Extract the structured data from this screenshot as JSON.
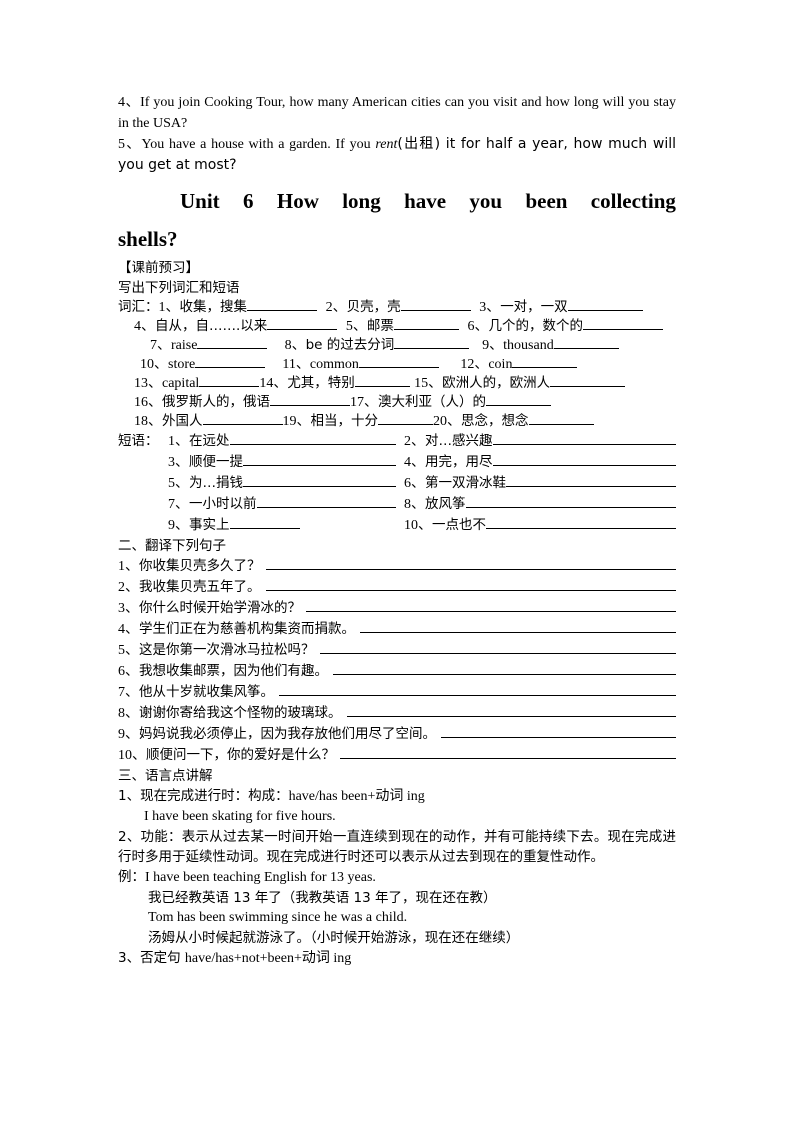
{
  "prev_questions": [
    {
      "number": "4、",
      "text": "If you join Cooking Tour, how many American cities can you visit and how long will you stay in the USA?"
    },
    {
      "number": "5、",
      "text_before_italic": "You have a house with a garden. If you ",
      "italic_word": "rent",
      "text_after_italic": "(出租) it for half a year, how much will you get at most?"
    }
  ],
  "unit_title": {
    "line1": "Unit 6 How long have you been collecting",
    "line1_words": [
      "Unit",
      "6",
      "How",
      "long",
      "have",
      "you",
      "been",
      "collecting"
    ],
    "line2": "shells?"
  },
  "preview": {
    "heading": "【课前预习】",
    "subheading": "写出下列词汇和短语",
    "vocab_label": "词汇：",
    "vocab_items": [
      {
        "num": "1、",
        "text": "收集，搜集",
        "blank": "b70"
      },
      {
        "num": "2、",
        "text": "贝壳，壳",
        "blank": "b70"
      },
      {
        "num": "3、",
        "text": "一对，一双",
        "blank": "b75"
      },
      {
        "num": "4、",
        "text": "自从，自…….以来",
        "blank": "b70"
      },
      {
        "num": "5、",
        "text": "邮票",
        "blank": "b65"
      },
      {
        "num": "6、",
        "text": "几个的，数个的",
        "blank": "b80"
      },
      {
        "num": "7、",
        "text": "raise",
        "blank": "b70",
        "english": true
      },
      {
        "num": "8、",
        "text": "be 的过去分词",
        "blank": "b75"
      },
      {
        "num": "9、",
        "text": "thousand",
        "blank": "b65",
        "english": true
      },
      {
        "num": "10、",
        "text": "store",
        "blank": "b70",
        "english": true
      },
      {
        "num": "11、",
        "text": "common",
        "blank": "b80",
        "english": true
      },
      {
        "num": "12、",
        "text": "coin",
        "blank": "b65",
        "english": true
      },
      {
        "num": "13、",
        "text": "capital",
        "blank": "b60",
        "english": true
      },
      {
        "num": "14、",
        "text": "尤其，特别",
        "blank": "b55"
      },
      {
        "num": "15、",
        "text": "欧洲人的，欧洲人",
        "blank": "b75"
      },
      {
        "num": "16、",
        "text": "俄罗斯人的，俄语",
        "blank": "b80"
      },
      {
        "num": "17、",
        "text": "澳大利亚（人）的",
        "blank": "b65"
      },
      {
        "num": "18、",
        "text": "外国人",
        "blank": "b80"
      },
      {
        "num": "19、",
        "text": "相当，十分",
        "blank": "b55"
      },
      {
        "num": "20、",
        "text": "思念，想念",
        "blank": "b65"
      }
    ],
    "phrase_label": "短语：",
    "phrases": [
      {
        "num": "1、",
        "text": "在远处"
      },
      {
        "num": "2、",
        "text": "对…感兴趣"
      },
      {
        "num": "3、",
        "text": "顺便一提"
      },
      {
        "num": "4、",
        "text": "用完，用尽"
      },
      {
        "num": "5、",
        "text": "为…捐钱"
      },
      {
        "num": "6、",
        "text": "第一双滑冰鞋 "
      },
      {
        "num": "7、",
        "text": "一小时以前"
      },
      {
        "num": "8、",
        "text": "放风筝"
      },
      {
        "num": "9、",
        "text": "事实上"
      },
      {
        "num": "10、",
        "text": "一点也不 "
      }
    ]
  },
  "translation": {
    "heading": "二、翻译下列句子",
    "sentences": [
      {
        "num": "1、",
        "text": "你收集贝壳多久了？"
      },
      {
        "num": "2、",
        "text": "我收集贝壳五年了。"
      },
      {
        "num": "3、",
        "text": "你什么时候开始学滑冰的？"
      },
      {
        "num": "4、",
        "text": "学生们正在为慈善机构集资而捐款。"
      },
      {
        "num": "5、",
        "text": "这是你第一次滑冰马拉松吗？"
      },
      {
        "num": "6、",
        "text": "我想收集邮票，因为他们有趣。"
      },
      {
        "num": "7、",
        "text": "他从十岁就收集风筝。"
      },
      {
        "num": "8、",
        "text": "谢谢你寄给我这个怪物的玻璃球。"
      },
      {
        "num": "9、",
        "text": "妈妈说我必须停止，因为我存放他们用尽了空间。"
      },
      {
        "num": "10、",
        "text": "顺便问一下，你的爱好是什么？"
      }
    ]
  },
  "grammar": {
    "heading": "三、语言点讲解",
    "point1_cn": "1、现在完成进行时：构成：",
    "point1_en": "have/has been+动词 ing",
    "point1_example": "I have been skating for five hours.",
    "point2": "2、功能：表示从过去某一时间开始一直连续到现在的动作，并有可能持续下去。现在完成进行时多用于延续性动词。现在完成进行时还可以表示从过去到现在的重复性动作。",
    "example_label": "例：",
    "example1_en": "I have been teaching English for 13 yeas.",
    "example1_cn": "我已经教英语 13 年了（我教英语 13 年了，现在还在教）",
    "example2_en": "Tom has been swimming since he was a child.",
    "example2_cn": "汤姆从小时候起就游泳了。（小时候开始游泳，现在还在继续）",
    "point3_cn": "3、否定句 ",
    "point3_en": "have/has+not+been+动词 ing"
  }
}
